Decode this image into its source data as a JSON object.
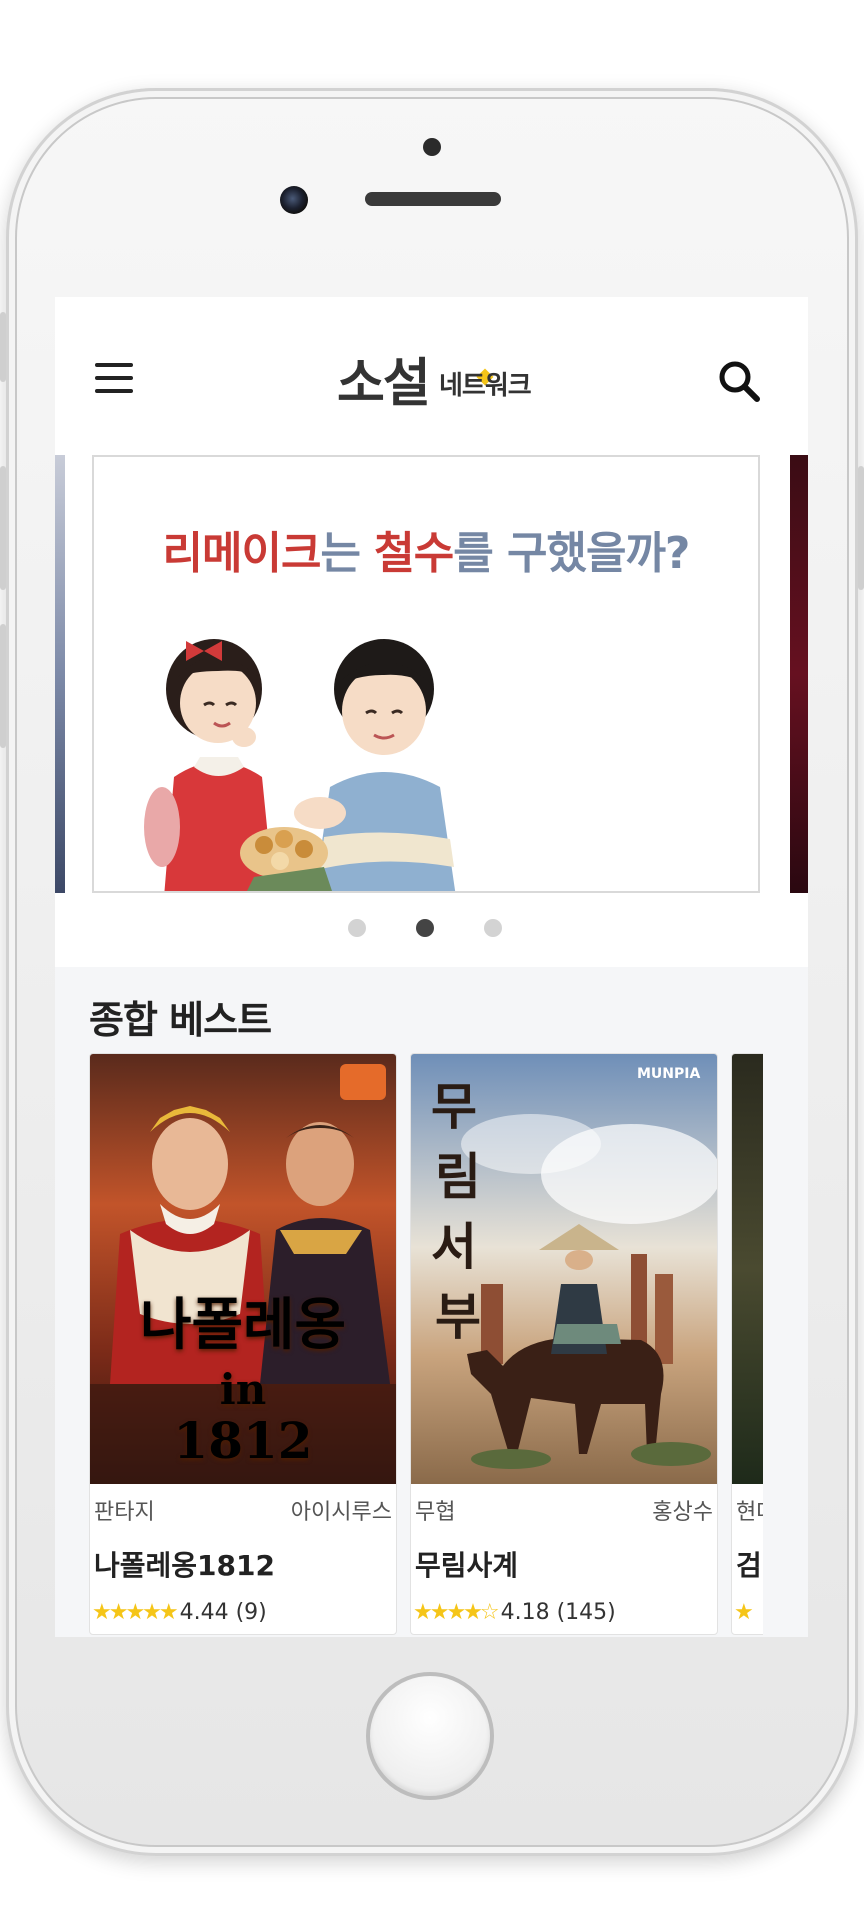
{
  "header": {
    "logo_main": "소설",
    "logo_sub": "네트워크",
    "menu_icon": "hamburger-icon",
    "search_icon": "search-icon"
  },
  "banner": {
    "title_parts": [
      "리메이크",
      "는 ",
      "철수",
      "를 구했을까?"
    ],
    "dots": 3,
    "active_dot": 1,
    "colors": {
      "red": "#c93a35",
      "blue": "#7587a4"
    }
  },
  "best": {
    "title": "종합 베스트",
    "books": [
      {
        "genre": "판타지",
        "author": "아이시루스",
        "title": "나폴레옹1812",
        "stars": "★★★★★",
        "rating": "4.44 (9)",
        "cover_title_line1": "나폴레옹",
        "cover_title_line2": "in",
        "cover_title_line3": "1812"
      },
      {
        "genre": "무협",
        "author": "홍상수",
        "title": "무림사계",
        "stars": "★★★★☆",
        "rating": "4.18 (145)",
        "cover_brand": "MUNPIA"
      },
      {
        "genre": "현대",
        "title": "검",
        "stars": "★"
      }
    ]
  }
}
